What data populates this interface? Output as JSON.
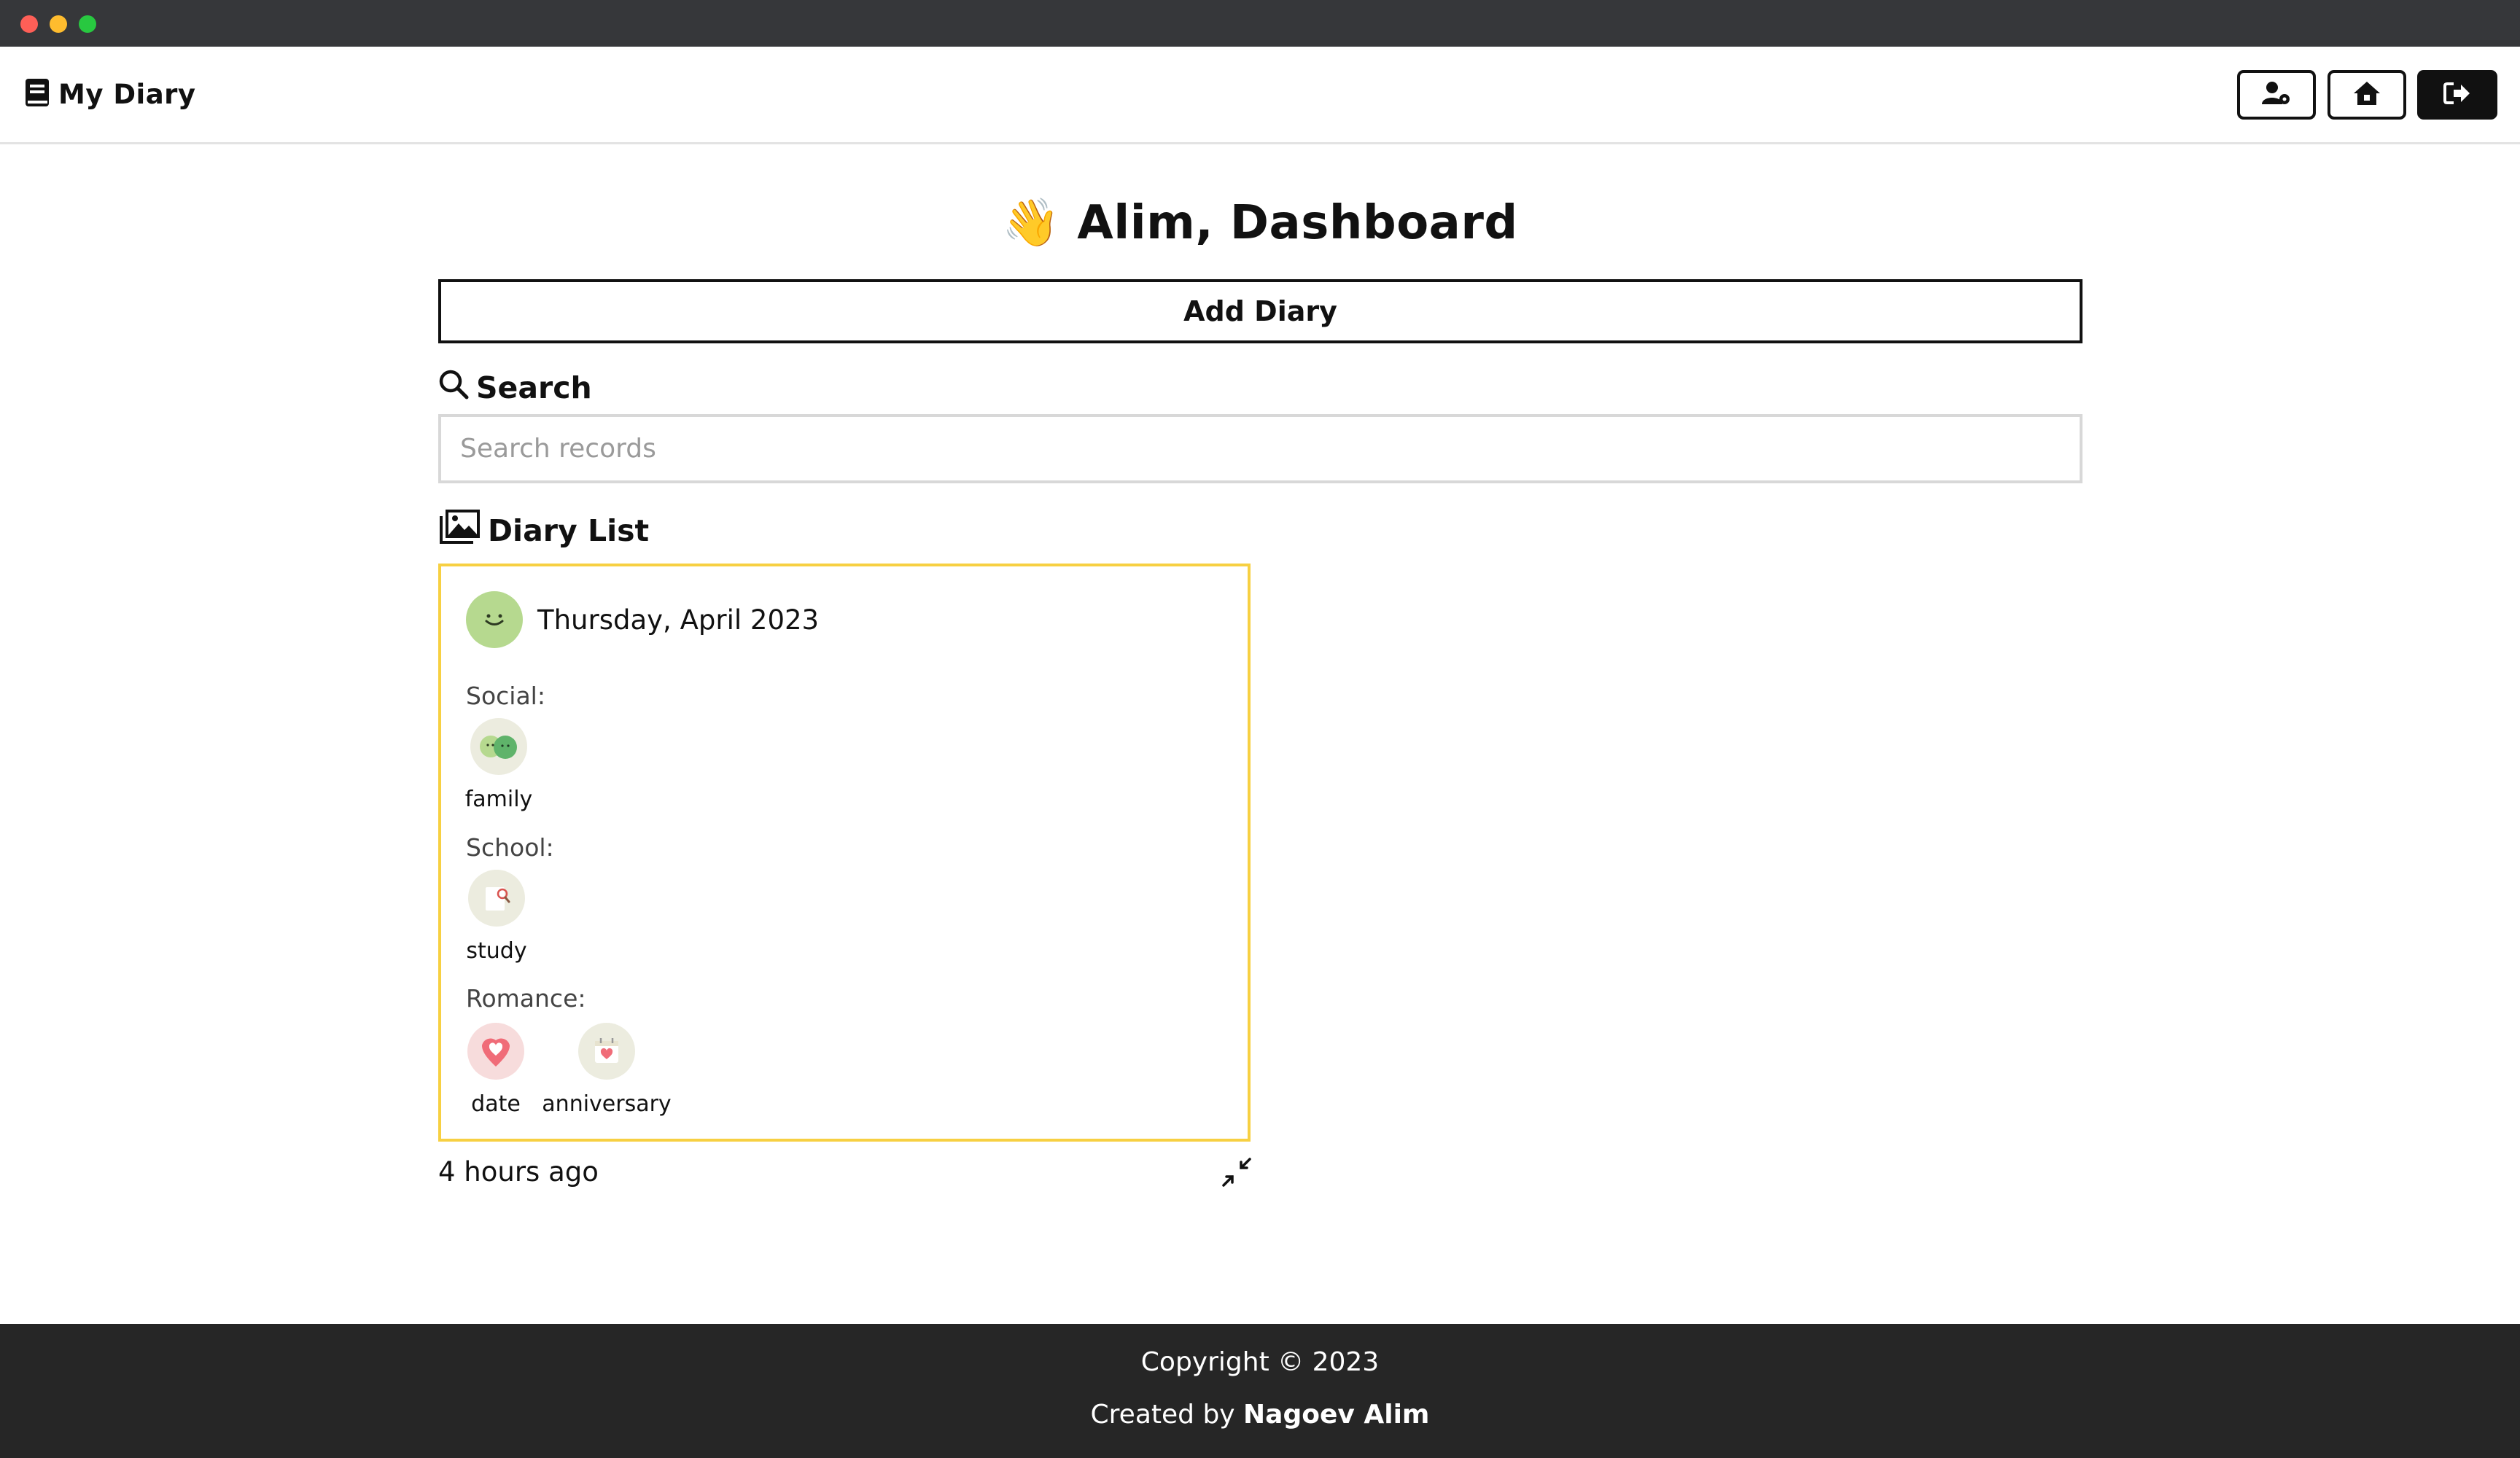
{
  "navbar": {
    "brand": "My Diary",
    "buttons": [
      {
        "icon": "user-settings-icon"
      },
      {
        "icon": "home-icon"
      },
      {
        "icon": "logout-icon"
      }
    ]
  },
  "main": {
    "greeting_emoji": "👋",
    "title": "Alim, Dashboard",
    "add_button": "Add Diary",
    "search_heading": "Search",
    "search_placeholder": "Search records",
    "search_value": "",
    "list_heading": "Diary List"
  },
  "diary_entries": [
    {
      "mood_icon": "smile-face-icon",
      "date": "Thursday, April 2023",
      "categories": [
        {
          "name": "Social:",
          "tags": [
            {
              "label": "family",
              "icon": "family-icon"
            }
          ]
        },
        {
          "name": "School:",
          "tags": [
            {
              "label": "study",
              "icon": "study-icon"
            }
          ]
        },
        {
          "name": "Romance:",
          "tags": [
            {
              "label": "date",
              "icon": "heart-pin-icon"
            },
            {
              "label": "anniversary",
              "icon": "calendar-heart-icon"
            }
          ]
        }
      ],
      "time_ago": "4 hours ago"
    }
  ],
  "footer": {
    "copyright": "Copyright © 2023",
    "created_prefix": "Created by ",
    "author": "Nagoev Alim"
  },
  "colors": {
    "chrome": "#36373a",
    "card_border": "#f7d042",
    "mood_green": "#b6d98f",
    "footer_bg": "#262626"
  }
}
